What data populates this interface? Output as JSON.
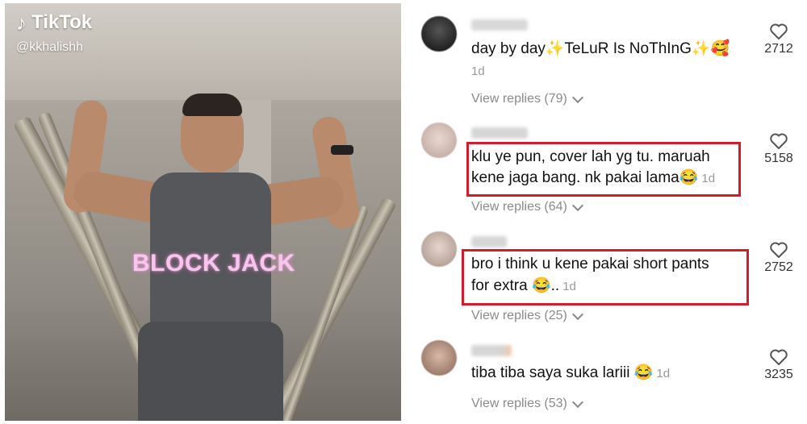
{
  "video": {
    "app_name": "TikTok",
    "handle": "@kkhalishh",
    "overlay_text": "BLOCK JACK"
  },
  "comments": [
    {
      "text": "day by day✨TeLuR Is NoThInG✨🥰",
      "time": "1d",
      "replies": "View replies (79)",
      "likes": "2712"
    },
    {
      "text_line1": "klu ye pun, cover lah yg tu. maruah",
      "text_line2": "kene jaga bang. nk pakai lama😂",
      "time": "1d",
      "replies": "View replies (64)",
      "likes": "5158"
    },
    {
      "text_line1": "bro i think u kene pakai short pants",
      "text_line2": "for extra 😂..",
      "time": "1d",
      "replies": "View replies (25)",
      "likes": "2752"
    },
    {
      "text": "tiba tiba saya suka lariii 😂",
      "time": "1d",
      "replies": "View replies (53)",
      "likes": "3235"
    }
  ],
  "colors": {
    "highlight": "#d21b2b",
    "overlay_pink": "#f6c6ef"
  },
  "icons": {
    "like": "heart-outline-icon",
    "expand": "chevron-down-icon",
    "brand": "tiktok-note-icon"
  }
}
